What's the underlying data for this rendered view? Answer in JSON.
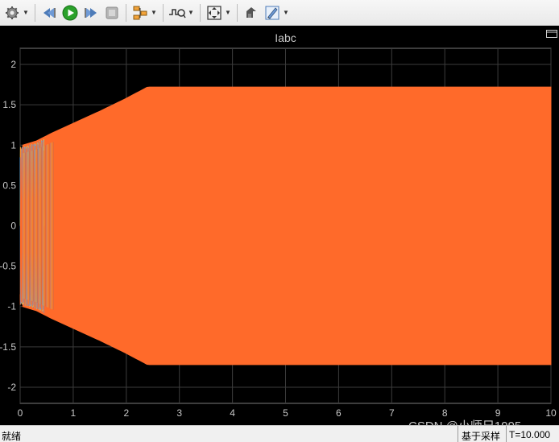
{
  "toolbar": {
    "buttons": [
      {
        "name": "parameters-gear-icon",
        "dropdown": true
      },
      {
        "name": "step-back-icon",
        "dropdown": false
      },
      {
        "name": "run-play-icon",
        "dropdown": false
      },
      {
        "name": "step-forward-icon",
        "dropdown": false
      },
      {
        "name": "stop-icon",
        "dropdown": false
      },
      {
        "name": "highlight-block-icon",
        "dropdown": true
      },
      {
        "name": "triggers-icon",
        "dropdown": true
      },
      {
        "name": "zoom-fit-icon",
        "dropdown": true
      },
      {
        "name": "cursor-measure-icon",
        "dropdown": false
      },
      {
        "name": "style-pen-icon",
        "dropdown": true
      }
    ],
    "accent_green": "#2aa12a"
  },
  "chart_data": {
    "type": "line",
    "title": "Iabc",
    "xlabel": "",
    "ylabel": "",
    "xlim": [
      0,
      10
    ],
    "ylim": [
      -2.2,
      2.2
    ],
    "x_ticks": [
      "0",
      "1",
      "2",
      "3",
      "4",
      "5",
      "6",
      "7",
      "8",
      "9",
      "10"
    ],
    "y_ticks": [
      "2",
      "1.5",
      "1",
      "0.5",
      "0",
      "-0.5",
      "-1",
      "-1.5",
      "-2"
    ],
    "grid": true,
    "background": "#000000",
    "series": [
      {
        "color": "#ff6a2a",
        "envelope_t": [
          0.05,
          0.3,
          0.6,
          1.0,
          1.5,
          2.0,
          2.4,
          10.0
        ],
        "envelope_amp": [
          1.0,
          1.05,
          1.15,
          1.27,
          1.42,
          1.58,
          1.72,
          1.72
        ]
      },
      {
        "color": "#f5e23a",
        "envelope_t": [
          0.0,
          0.45
        ],
        "envelope_amp": [
          1.0,
          1.0
        ]
      },
      {
        "color": "#3fa0ff",
        "envelope_t": [
          0.0,
          0.45
        ],
        "envelope_amp": [
          1.0,
          1.0
        ]
      }
    ]
  },
  "status": {
    "left": "就绪",
    "mode": "基于采样",
    "time": "T=10.000"
  },
  "watermark": "CSDN @小师兄1995"
}
